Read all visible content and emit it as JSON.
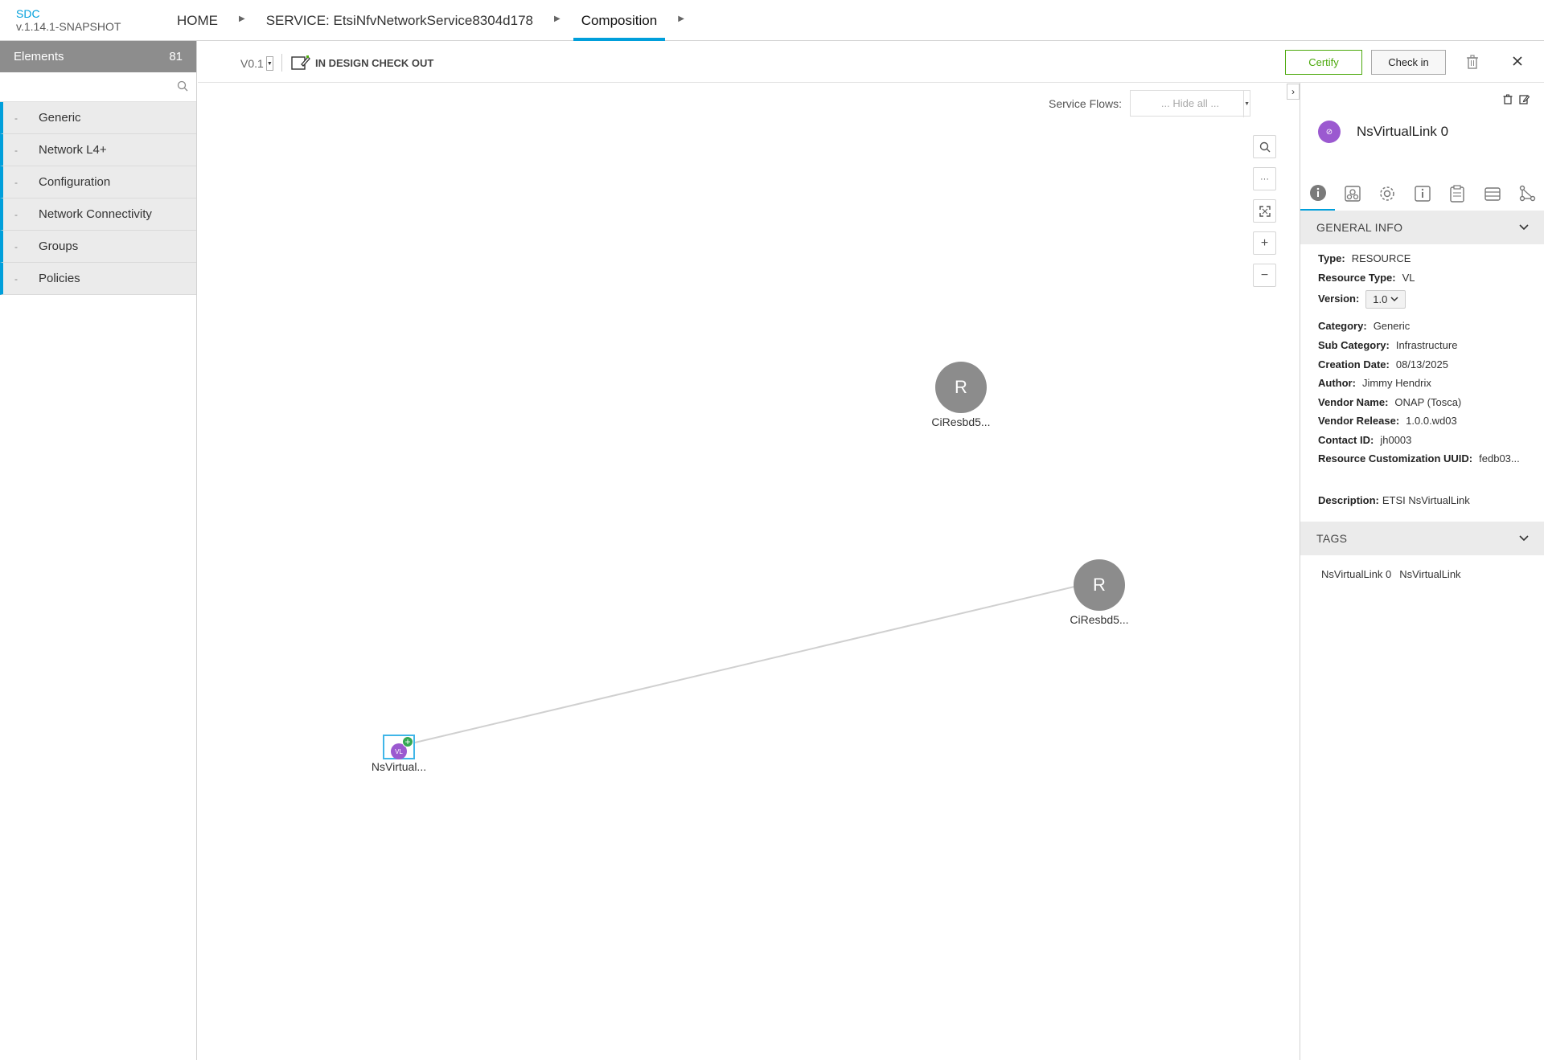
{
  "header": {
    "app_name": "SDC",
    "app_version": "v.1.14.1-SNAPSHOT",
    "breadcrumbs": [
      {
        "label": "HOME"
      },
      {
        "label": "SERVICE: EtsiNfvNetworkService8304d178"
      },
      {
        "label": "Composition"
      }
    ]
  },
  "palette": {
    "title": "Elements",
    "count": "81",
    "search_placeholder": "",
    "categories": [
      {
        "label": "Generic"
      },
      {
        "label": "Network L4+"
      },
      {
        "label": "Configuration"
      },
      {
        "label": "Network Connectivity"
      },
      {
        "label": "Groups"
      },
      {
        "label": "Policies"
      }
    ]
  },
  "toolbar": {
    "version": "V0.1",
    "state": "IN DESIGN CHECK OUT",
    "certify_label": "Certify",
    "checkin_label": "Check in"
  },
  "canvas": {
    "service_flows_label": "Service Flows:",
    "service_flows_value": "... Hide all ...",
    "zoom_buttons": [
      {
        "name": "search-icon",
        "glyph": "⌕"
      },
      {
        "name": "more-icon",
        "glyph": "···"
      },
      {
        "name": "fit-screen-icon",
        "glyph": "⤢"
      },
      {
        "name": "zoom-in-icon",
        "glyph": "+"
      },
      {
        "name": "zoom-out-icon",
        "glyph": "−"
      }
    ],
    "nodes": [
      {
        "initial": "R",
        "label": "CiResbd5..."
      },
      {
        "initial": "R",
        "label": "CiResbd5..."
      }
    ],
    "vl_node": {
      "label": "NsVirtual...",
      "badge": "VL"
    }
  },
  "right_panel": {
    "title": "NsVirtualLink 0",
    "general_info_title": "GENERAL INFO",
    "info": {
      "type_label": "Type:",
      "type": "RESOURCE",
      "resource_type_label": "Resource Type:",
      "resource_type": "VL",
      "version_label": "Version:",
      "version": "1.0",
      "category_label": "Category:",
      "category": "Generic",
      "sub_category_label": "Sub Category:",
      "sub_category": "Infrastructure",
      "creation_date_label": "Creation Date:",
      "creation_date": "08/13/2025",
      "author_label": "Author:",
      "author": "Jimmy Hendrix",
      "vendor_name_label": "Vendor Name:",
      "vendor_name": "ONAP (Tosca)",
      "vendor_release_label": "Vendor Release:",
      "vendor_release": "1.0.0.wd03",
      "contact_id_label": "Contact ID:",
      "contact_id": "jh0003",
      "uuid_label": "Resource Customization UUID:",
      "uuid": "fedb03...",
      "description_label": "Description:",
      "description": "ETSI NsVirtualLink"
    },
    "tags_title": "TAGS",
    "tags": [
      "NsVirtualLink 0",
      "NsVirtualLink"
    ]
  },
  "colors": {
    "accent": "#009fdb",
    "certify": "#4ca90c",
    "vl_purple": "#9b59d0",
    "node_gray": "#8c8c8c"
  }
}
